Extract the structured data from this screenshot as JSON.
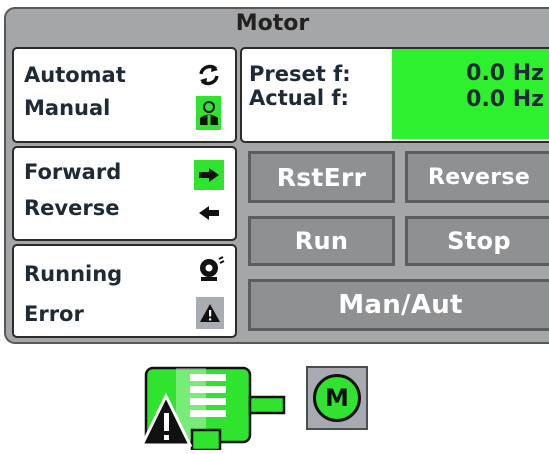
{
  "faceplate": {
    "title": "Motor"
  },
  "mode": {
    "automat_label": "Automat",
    "manual_label": "Manual",
    "automat_icon": "refresh-icon",
    "manual_icon": "operator-icon"
  },
  "frequency": {
    "preset_label": "Preset f:",
    "preset_value": "0.0 Hz",
    "actual_label": "Actual f:",
    "actual_value": "0.0 Hz"
  },
  "direction": {
    "forward_label": "Forward",
    "reverse_label": "Reverse",
    "forward_icon": "arrow-right-icon",
    "reverse_icon": "arrow-left-icon"
  },
  "state": {
    "running_label": "Running",
    "error_label": "Error",
    "running_icon": "motor-icon",
    "error_icon": "warning-icon"
  },
  "buttons": {
    "rst_err": "RstErr",
    "reverse": "Reverse",
    "run": "Run",
    "stop": "Stop",
    "man_aut": "Man/Aut"
  },
  "symbols": {
    "motor_icon": "motor-warning-icon",
    "m_badge": "M"
  },
  "colors": {
    "active_green": "#2fe32f",
    "button_gray": "#8f9092",
    "panel_gray": "#a5a6a8"
  }
}
